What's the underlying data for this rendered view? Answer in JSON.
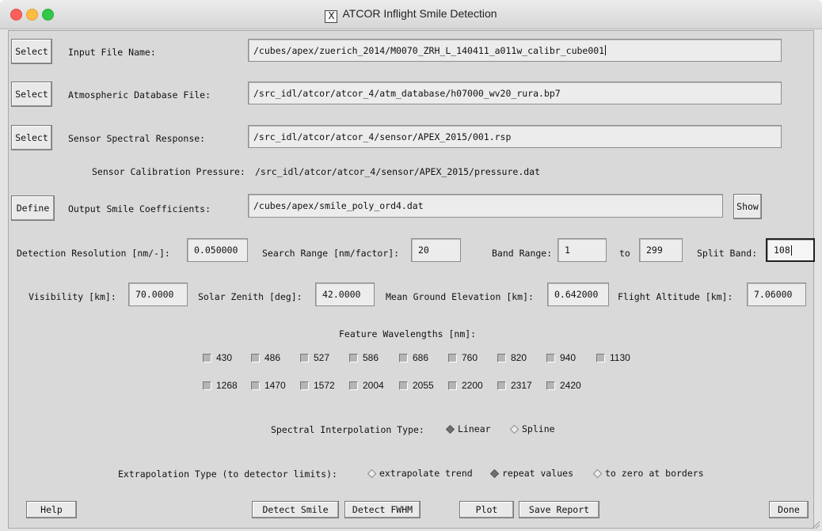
{
  "window": {
    "title": "ATCOR Inflight Smile Detection",
    "x_icon": "X"
  },
  "files": [
    {
      "button": "Select",
      "label": "Input File Name:",
      "value": "/cubes/apex/zuerich_2014/M0070_ZRH_L_140411_a011w_calibr_cube001"
    },
    {
      "button": "Select",
      "label": "Atmospheric Database File:",
      "value": "/src_idl/atcor/atcor_4/atm_database/h07000_wv20_rura.bp7"
    },
    {
      "button": "Select",
      "label": "Sensor Spectral Response:",
      "value": "/src_idl/atcor/atcor_4/sensor/APEX_2015/001.rsp"
    }
  ],
  "calibration": {
    "label": "Sensor Calibration Pressure:",
    "value": "/src_idl/atcor/atcor_4/sensor/APEX_2015/pressure.dat"
  },
  "output": {
    "button": "Define",
    "label": "Output Smile Coefficients:",
    "value": "/cubes/apex/smile_poly_ord4.dat",
    "show_button": "Show"
  },
  "params1": {
    "detection_label": "Detection Resolution [nm/-]:",
    "detection_value": "0.050000",
    "search_label": "Search Range [nm/factor]:",
    "search_value": "20",
    "band_label": "Band Range:",
    "band_from": "1",
    "to_label": "to",
    "band_to": "299",
    "split_label": "Split Band:",
    "split_value": "108"
  },
  "params2": {
    "visibility_label": "Visibility [km]:",
    "visibility_value": "70.0000",
    "zenith_label": "Solar Zenith [deg]:",
    "zenith_value": "42.0000",
    "ground_label": "Mean Ground Elevation [km]:",
    "ground_value": "0.642000",
    "altitude_label": "Flight Altitude [km]:",
    "altitude_value": "7.06000"
  },
  "features": {
    "title": "Feature Wavelengths [nm]:",
    "row1": [
      "430",
      "486",
      "527",
      "586",
      "686",
      "760",
      "820",
      "940",
      "1130"
    ],
    "row2": [
      "1268",
      "1470",
      "1572",
      "2004",
      "2055",
      "2200",
      "2317",
      "2420"
    ]
  },
  "interpolation": {
    "label": "Spectral Interpolation Type:",
    "options": [
      "Linear",
      "Spline"
    ],
    "selected": "Linear"
  },
  "extrapolation": {
    "label": "Extrapolation Type (to detector limits):",
    "options": [
      "extrapolate trend",
      "repeat values",
      "to zero at borders"
    ],
    "selected": "repeat values"
  },
  "buttons": {
    "help": "Help",
    "detect_smile": "Detect Smile",
    "detect_fwhm": "Detect FWHM",
    "plot": "Plot",
    "save_report": "Save Report",
    "done": "Done"
  }
}
